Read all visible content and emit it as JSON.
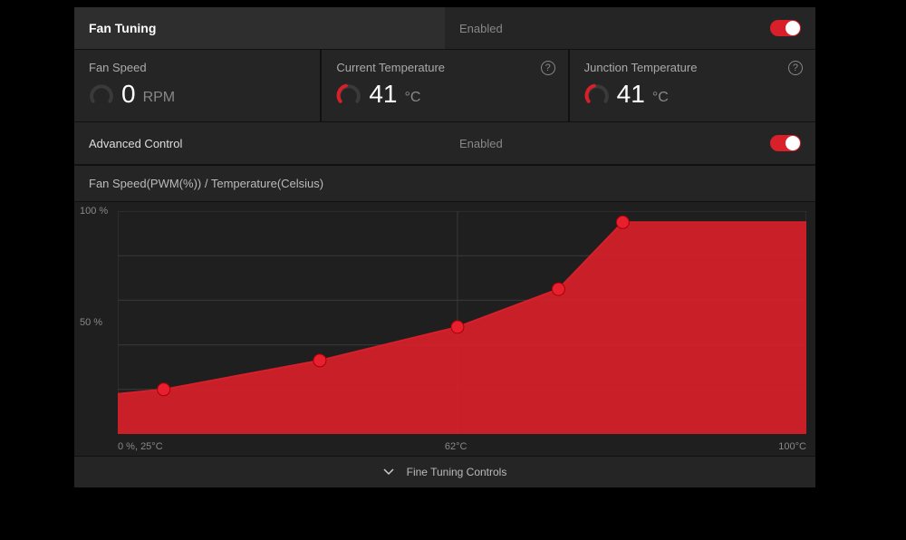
{
  "header": {
    "title": "Fan Tuning",
    "status": "Enabled"
  },
  "metrics": {
    "fan_speed": {
      "label": "Fan Speed",
      "value": "0",
      "unit": "RPM"
    },
    "current_temp": {
      "label": "Current Temperature",
      "value": "41",
      "unit": "°C"
    },
    "junction_temp": {
      "label": "Junction Temperature",
      "value": "41",
      "unit": "°C"
    }
  },
  "advanced": {
    "title": "Advanced Control",
    "status": "Enabled"
  },
  "chart_header": "Fan Speed(PWM(%)) / Temperature(Celsius)",
  "chart_data": {
    "type": "area",
    "title": "Fan Speed(PWM(%)) / Temperature(Celsius)",
    "xlabel": "Temperature (°C)",
    "ylabel": "Fan Speed (PWM %)",
    "xlim": [
      25,
      100
    ],
    "ylim": [
      0,
      100
    ],
    "x": [
      25,
      30,
      47,
      62,
      73,
      80,
      100
    ],
    "values": [
      18,
      20,
      33,
      48,
      65,
      95,
      95
    ],
    "markers": [
      {
        "x": 30,
        "y": 20
      },
      {
        "x": 47,
        "y": 33
      },
      {
        "x": 62,
        "y": 48
      },
      {
        "x": 73,
        "y": 65
      },
      {
        "x": 80,
        "y": 95
      }
    ],
    "y_ticks": [
      {
        "v": 100,
        "label": "100 %"
      },
      {
        "v": 50,
        "label": "50 %"
      }
    ],
    "x_ticks": [
      {
        "v": 25,
        "label": "0 %, 25°C"
      },
      {
        "v": 62,
        "label": "62°C"
      },
      {
        "v": 100,
        "label": "100°C"
      }
    ]
  },
  "footer": "Fine Tuning Controls",
  "colors": {
    "accent": "#d81f2a"
  }
}
